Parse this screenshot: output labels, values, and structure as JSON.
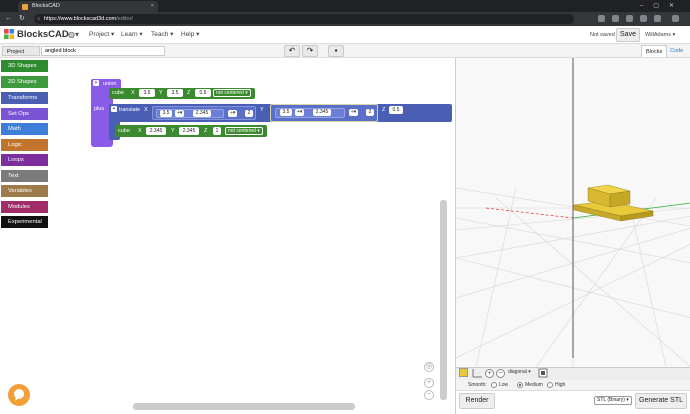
{
  "browser": {
    "tab_title": "BlocksCAD",
    "url_domain": "https://www.blockscad3d.com",
    "url_path": "/editor/"
  },
  "header": {
    "logo": "BlocksCAD",
    "menus": [
      "Project",
      "Learn",
      "Teach",
      "Help"
    ],
    "not_saved": "Not saved",
    "save_label": "Save",
    "user": "WillAdams"
  },
  "toolbar": {
    "project_name_label": "Project Name",
    "project_name_value": "angled block",
    "view_tabs": [
      "Blocks",
      "Code"
    ]
  },
  "categories": [
    {
      "label": "3D Shapes",
      "color": "#2e8b2e"
    },
    {
      "label": "2D Shapes",
      "color": "#3d9a3d"
    },
    {
      "label": "Transforms",
      "color": "#4a5fb4"
    },
    {
      "label": "Set Ops",
      "color": "#7a52d6"
    },
    {
      "label": "Math",
      "color": "#3d7ed8"
    },
    {
      "label": "Logic",
      "color": "#c0742c"
    },
    {
      "label": "Loops",
      "color": "#7b2f9c"
    },
    {
      "label": "Text",
      "color": "#7b7b7b"
    },
    {
      "label": "Variables",
      "color": "#9c7a4a"
    },
    {
      "label": "Modules",
      "color": "#a02c68"
    },
    {
      "label": "Experimental",
      "color": "#111111"
    }
  ],
  "blocks": {
    "union_label": "union",
    "plus_label": "plus",
    "cube1": {
      "label": "cube",
      "x": "3.5",
      "y": "3.5",
      "z": "0.5",
      "centered": "not centered"
    },
    "translate": {
      "label": "translate",
      "x_a": "3.5",
      "x_op": "+",
      "x_b": "2.345",
      "x_div_op": "÷",
      "x_div": "2",
      "y_a": "3.5",
      "y_op": "+",
      "y_b": "2.345",
      "y_div_op": "÷",
      "y_div": "2",
      "z": "0.5"
    },
    "cube2": {
      "label": "cube",
      "x": "2.345",
      "y": "2.345",
      "z": "1",
      "centered": "not centered"
    },
    "axis_labels": {
      "x": "X",
      "y": "Y",
      "z": "Z"
    }
  },
  "render_panel": {
    "view_select": "diagonal",
    "smooth_label": "Smooth:",
    "smooth_options": [
      "Low",
      "Medium",
      "High"
    ],
    "smooth_selected": "Medium",
    "render_label": "Render",
    "format_select": "STL (Binary)",
    "generate_label": "Generate STL",
    "model_color": "#e8c93a"
  }
}
